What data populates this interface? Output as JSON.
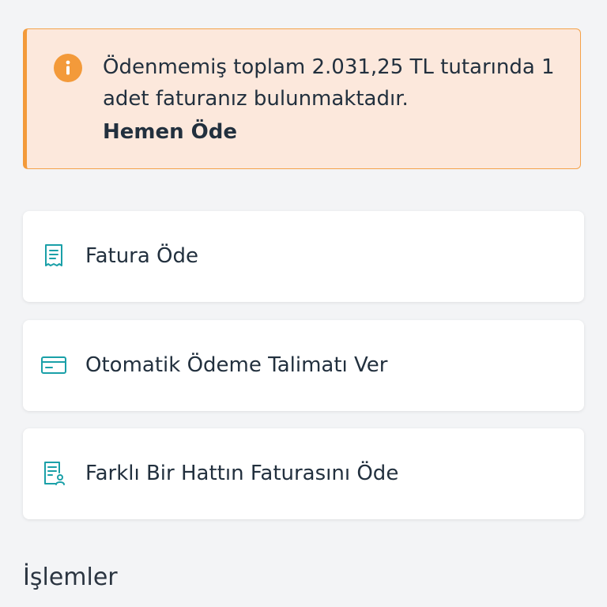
{
  "alert": {
    "icon": "info-icon",
    "message": "Ödenmemiş toplam 2.031,25 TL tutarında 1 adet faturanız bulunmaktadır.",
    "action_label": "Hemen Öde",
    "accent_color": "#f39a3a",
    "background_color": "#fce8dc"
  },
  "menu": {
    "items": [
      {
        "icon": "receipt-icon",
        "label": "Fatura Öde"
      },
      {
        "icon": "credit-card-icon",
        "label": "Otomatik Ödeme Talimatı Ver"
      },
      {
        "icon": "bill-user-icon",
        "label": "Farklı Bir Hattın Faturasını Öde"
      }
    ],
    "icon_color": "#1aa0a8"
  },
  "section": {
    "title": "İşlemler"
  }
}
